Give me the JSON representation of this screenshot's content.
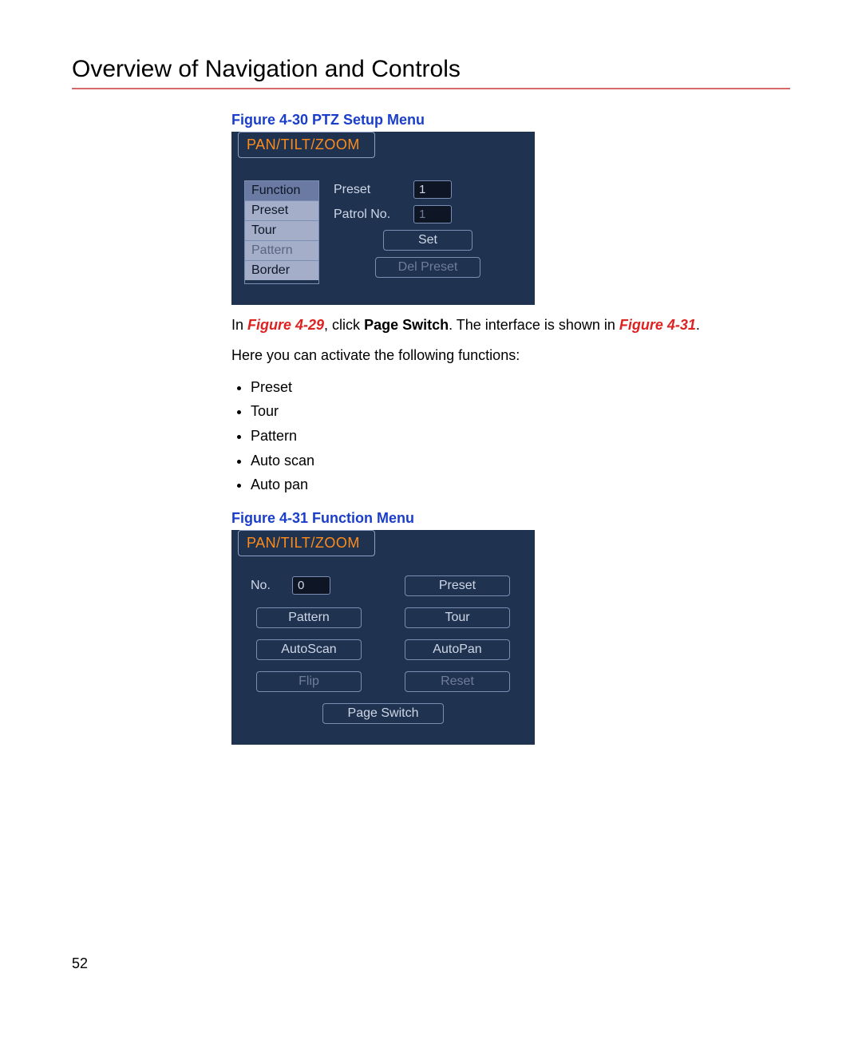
{
  "heading": "Overview of Navigation and Controls",
  "page_number": "52",
  "figure_30": {
    "caption": "Figure 4-30 PTZ Setup Menu",
    "tab": "PAN/TILT/ZOOM",
    "list": {
      "function": "Function",
      "preset": "Preset",
      "tour": "Tour",
      "pattern": "Pattern",
      "border": "Border"
    },
    "right": {
      "preset_label": "Preset",
      "preset_value": "1",
      "patrol_label": "Patrol No.",
      "patrol_value": "1",
      "set_btn": "Set",
      "del_btn": "Del Preset"
    }
  },
  "para1": {
    "in": "In ",
    "ref1": "Figure 4-29",
    "mid1": ", click ",
    "bold": "Page Switch",
    "mid2": ". The interface is shown in ",
    "ref2": "Figure 4-31",
    "end": "."
  },
  "para2": "Here you can activate the following functions:",
  "bullets": {
    "b1": "Preset",
    "b2": "Tour",
    "b3": "Pattern",
    "b4": "Auto scan",
    "b5": "Auto pan"
  },
  "figure_31": {
    "caption": "Figure 4-31 Function Menu",
    "tab": "PAN/TILT/ZOOM",
    "no_label": "No.",
    "no_value": "0",
    "btns": {
      "preset": "Preset",
      "pattern": "Pattern",
      "tour": "Tour",
      "autoscan": "AutoScan",
      "autopan": "AutoPan",
      "flip": "Flip",
      "reset": "Reset",
      "pageswitch": "Page Switch"
    }
  }
}
